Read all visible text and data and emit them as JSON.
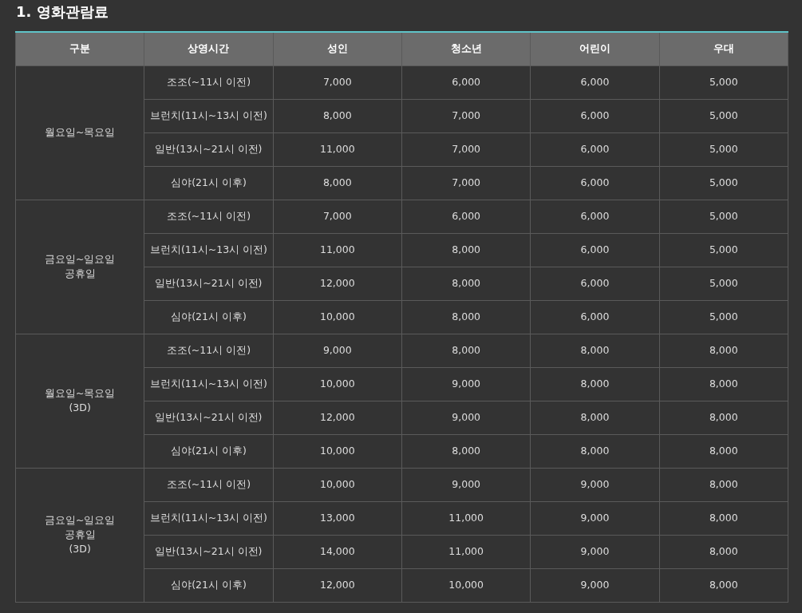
{
  "title": "1. 영화관람료",
  "table": {
    "columns": [
      "구분",
      "상영시간",
      "성인",
      "청소년",
      "어린이",
      "우대"
    ],
    "groups": [
      {
        "label_lines": [
          "월요일~목요일"
        ],
        "rows": [
          [
            "조조(~11시 이전)",
            "7,000",
            "6,000",
            "6,000",
            "5,000"
          ],
          [
            "브런치(11시~13시 이전)",
            "8,000",
            "7,000",
            "6,000",
            "5,000"
          ],
          [
            "일반(13시~21시 이전)",
            "11,000",
            "7,000",
            "6,000",
            "5,000"
          ],
          [
            "심야(21시 이후)",
            "8,000",
            "7,000",
            "6,000",
            "5,000"
          ]
        ]
      },
      {
        "label_lines": [
          "금요일~일요일",
          "공휴일"
        ],
        "rows": [
          [
            "조조(~11시 이전)",
            "7,000",
            "6,000",
            "6,000",
            "5,000"
          ],
          [
            "브런치(11시~13시 이전)",
            "11,000",
            "8,000",
            "6,000",
            "5,000"
          ],
          [
            "일반(13시~21시 이전)",
            "12,000",
            "8,000",
            "6,000",
            "5,000"
          ],
          [
            "심야(21시 이후)",
            "10,000",
            "8,000",
            "6,000",
            "5,000"
          ]
        ]
      },
      {
        "label_lines": [
          "월요일~목요일",
          "(3D)"
        ],
        "rows": [
          [
            "조조(~11시 이전)",
            "9,000",
            "8,000",
            "8,000",
            "8,000"
          ],
          [
            "브런치(11시~13시 이전)",
            "10,000",
            "9,000",
            "8,000",
            "8,000"
          ],
          [
            "일반(13시~21시 이전)",
            "12,000",
            "9,000",
            "8,000",
            "8,000"
          ],
          [
            "심야(21시 이후)",
            "10,000",
            "8,000",
            "8,000",
            "8,000"
          ]
        ]
      },
      {
        "label_lines": [
          "금요일~일요일",
          "공휴일",
          "(3D)"
        ],
        "rows": [
          [
            "조조(~11시 이전)",
            "10,000",
            "9,000",
            "9,000",
            "8,000"
          ],
          [
            "브런치(11시~13시 이전)",
            "13,000",
            "11,000",
            "9,000",
            "8,000"
          ],
          [
            "일반(13시~21시 이전)",
            "14,000",
            "11,000",
            "9,000",
            "8,000"
          ],
          [
            "심야(21시 이후)",
            "12,000",
            "10,000",
            "9,000",
            "8,000"
          ]
        ]
      }
    ]
  }
}
